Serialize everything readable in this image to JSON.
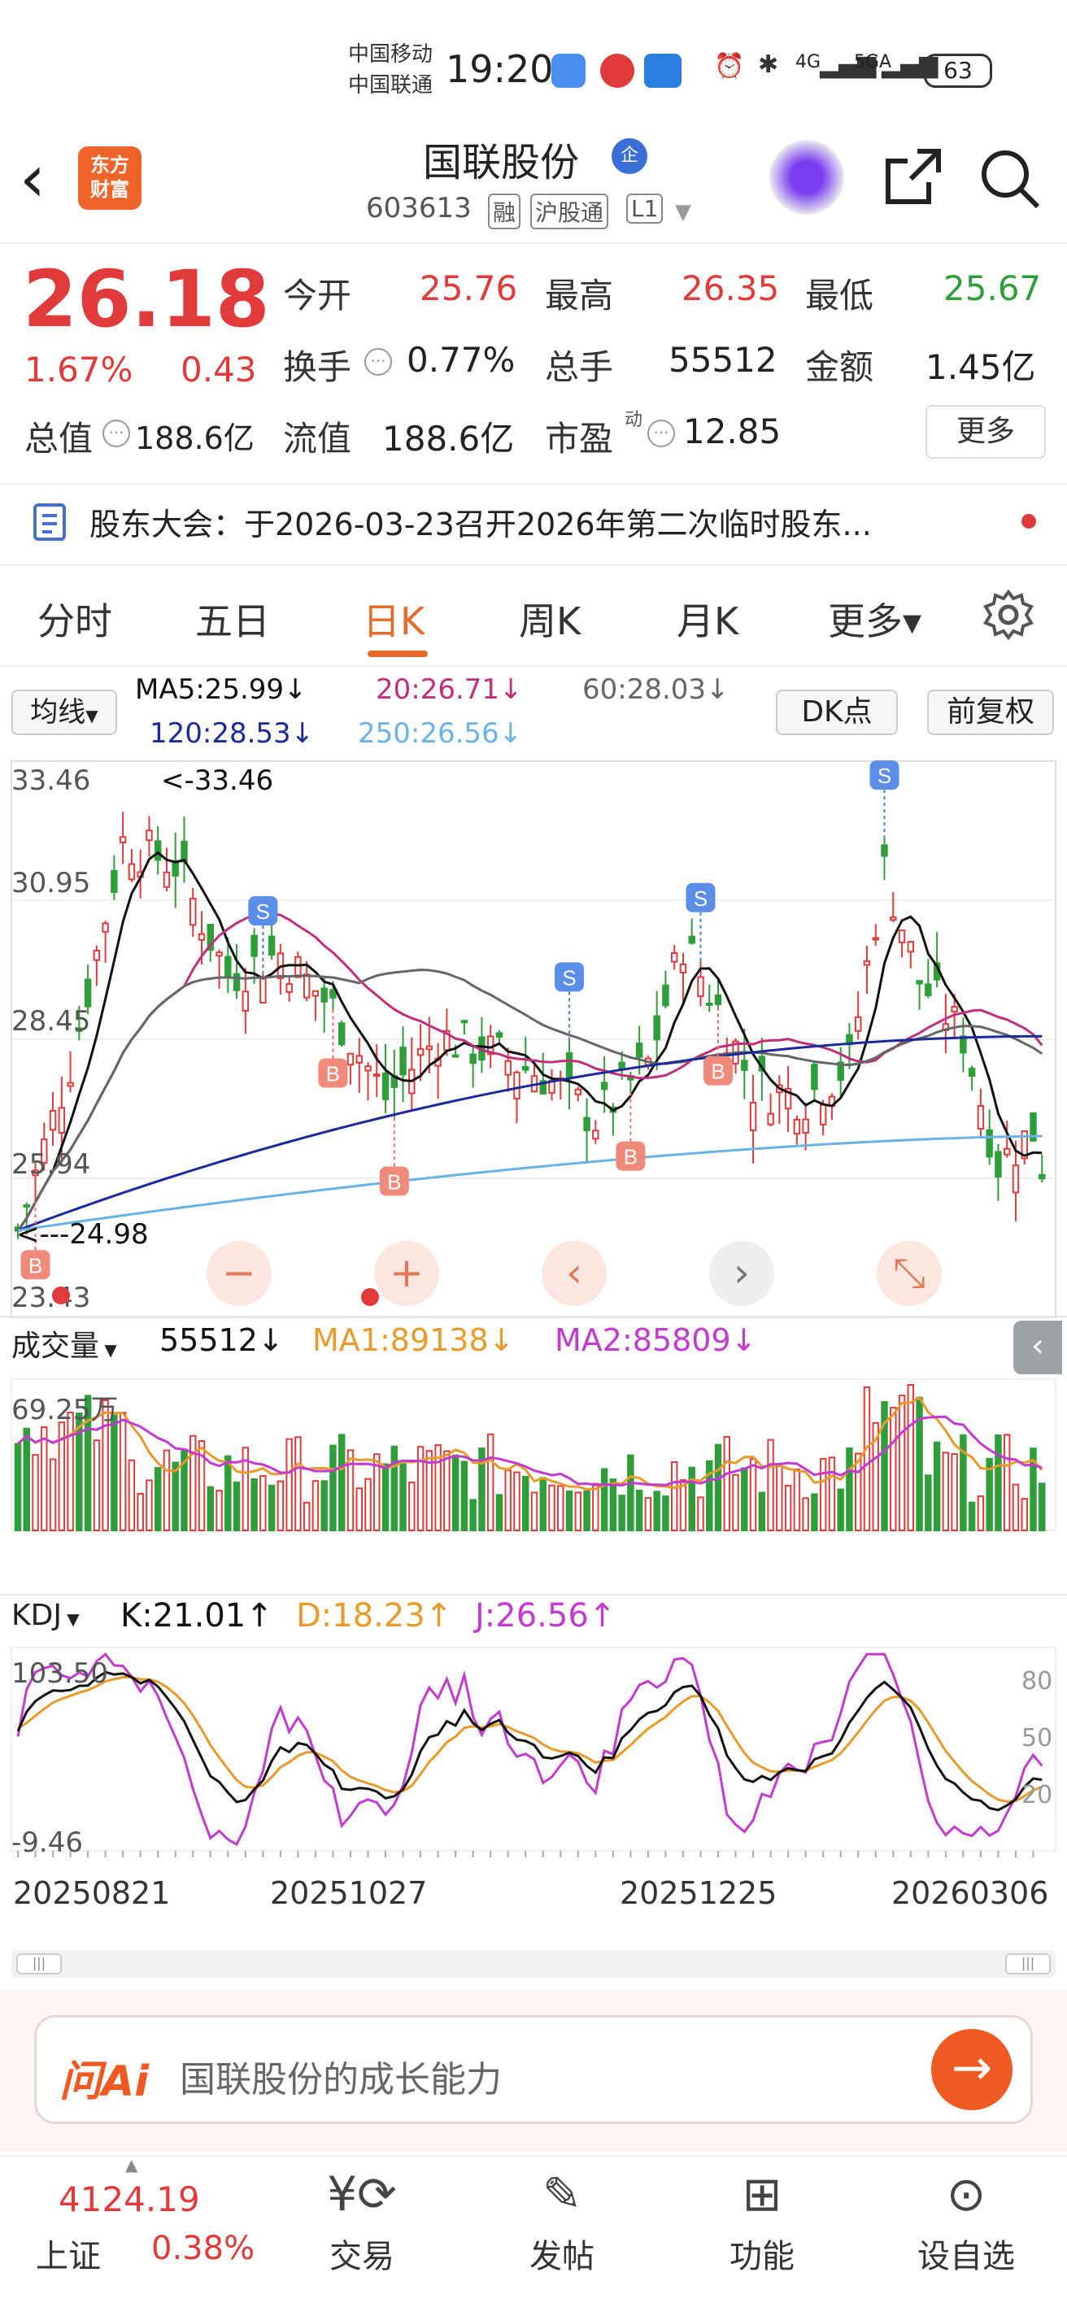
{
  "status_bar": {
    "carrier1": "中国移动",
    "carrier2": "中国联通",
    "time": "19:20",
    "signal1": "4G",
    "signal2": "5GA",
    "battery": "63"
  },
  "header": {
    "logo_line1": "东方",
    "logo_line2": "财富",
    "stock_name": "国联股份",
    "qi_badge": "企",
    "stock_code": "603613",
    "tags": [
      "融",
      "沪股通",
      "L1"
    ]
  },
  "quote": {
    "price": "26.18",
    "change_pct": "1.67%",
    "change": "0.43",
    "open_label": "今开",
    "open": "25.76",
    "high_label": "最高",
    "high": "26.35",
    "low_label": "最低",
    "low": "25.67",
    "turnover_label": "换手",
    "turnover": "0.77%",
    "volume_label": "总手",
    "volume": "55512",
    "amount_label": "金额",
    "amount": "1.45亿",
    "mktcap_label": "总值",
    "mktcap": "188.6亿",
    "float_label": "流值",
    "float": "188.6亿",
    "pe_label": "市盈",
    "pe_sup": "动",
    "pe": "12.85",
    "more": "更多"
  },
  "notice": {
    "text": "股东大会：于2026-03-23召开2026年第二次临时股东..."
  },
  "tabs": [
    "分时",
    "五日",
    "日K",
    "周K",
    "月K",
    "更多▾"
  ],
  "active_tab": 2,
  "chart": {
    "ma_selector": "均线",
    "ma5": "MA5:25.99↓",
    "ma20": "20:26.71↓",
    "ma60": "60:28.03↓",
    "ma120": "120:28.53↓",
    "ma250": "250:26.56↓",
    "dk_button": "DK点",
    "adjust_button": "前复权",
    "y_top": "33.46",
    "y_2": "30.95",
    "y_3": "28.45",
    "y_4": "25.94",
    "y_bottom": "23.43",
    "max_marker": "<-33.46",
    "min_marker": "<---24.98",
    "vol_selector": "成交量",
    "vol_value": "55512↓",
    "vol_ma1": "MA1:89138↓",
    "vol_ma2": "MA2:85809↓",
    "vol_max": "69.25万",
    "kdj_selector": "KDJ",
    "kdj_k": "K:21.01↑",
    "kdj_d": "D:18.23↑",
    "kdj_j": "J:26.56↑",
    "kdj_top": "103.50",
    "kdj_bottom": "-9.46",
    "kdj_r80": "80",
    "kdj_r50": "50",
    "kdj_r20": "20",
    "dates": [
      "20250821",
      "20251027",
      "20251225",
      "20260306"
    ],
    "colors": {
      "up": "#e03a3a",
      "down": "#2f9e3a",
      "ma5": "#111111",
      "ma20": "#c0307a",
      "ma60": "#666666",
      "ma120": "#1a2a9a",
      "ma250": "#6ab2e6",
      "kdj_k": "#111111",
      "kdj_d": "#e89a2a",
      "kdj_j": "#c23ad0"
    }
  },
  "chart_data": {
    "type": "candlestick",
    "y_range": [
      23.43,
      33.46
    ],
    "max": 33.46,
    "min": 24.98,
    "latest_close": 26.18,
    "moving_averages": {
      "MA5": 25.99,
      "MA20": 26.71,
      "MA60": 28.03,
      "MA120": 28.53,
      "MA250": 26.56
    },
    "volume": {
      "latest": 55512,
      "MA1": 89138,
      "MA2": 85809,
      "axis_max": "69.25万"
    },
    "kdj": {
      "K": 21.01,
      "D": 18.23,
      "J": 26.56,
      "range": [
        -9.46,
        103.5
      ]
    },
    "x_labels": [
      "20250821",
      "20251027",
      "20251225",
      "20260306"
    ],
    "buy_sell_markers": [
      "B",
      "S",
      "B",
      "B",
      "S",
      "B",
      "B",
      "S",
      "S"
    ]
  },
  "ask": {
    "logo": "问Ai",
    "prompt": "国联股份的成长能力"
  },
  "bottom_nav": {
    "index_value": "4124.19",
    "index_name": "上证",
    "index_change": "0.38%",
    "items": [
      "交易",
      "发帖",
      "功能",
      "设自选"
    ]
  }
}
